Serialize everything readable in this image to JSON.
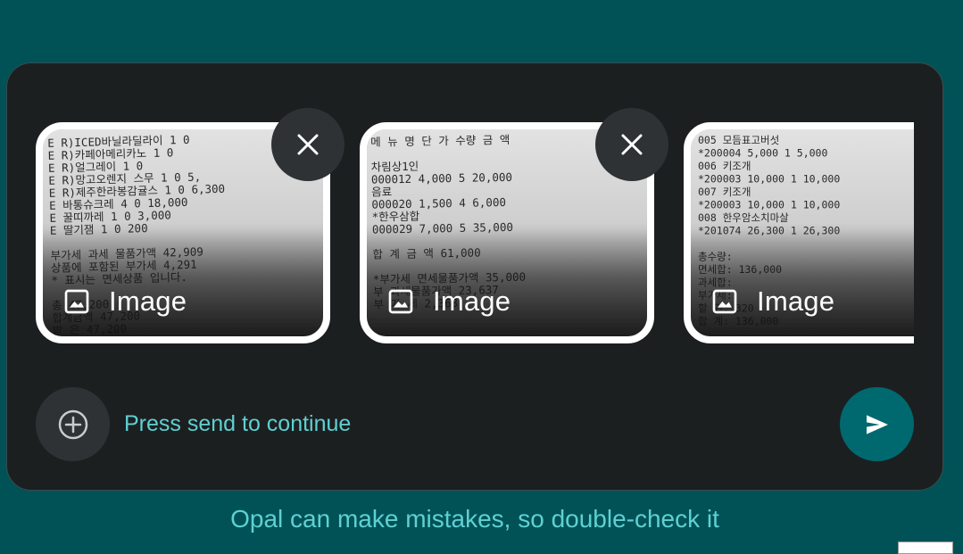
{
  "attachments": [
    {
      "label": "Image",
      "removable": true,
      "receipt_lines": [
        "E R)ICED바닐라딜라이   1    0",
        "E R)카페아메리카노     1    0",
        "E R)얼그레이           1    0",
        "E R)망고오렌지 스무    1    0     5,",
        "E R)제주한라봉감귤스   1    0  6,300",
        "E 바통슈크레           4    0 18,000",
        "E 꿀띠까레             1    0  3,000",
        "E 딸기잼               1    0    200",
        "",
        "부가세 과세 물품가액          42,909",
        "상품에 포함된 부가세           4,291",
        "   * 표시는 면세상품 입니다.",
        "",
        "총                         47,200",
        "합계금액                    47,200",
        "받  은                      47,200"
      ]
    },
    {
      "label": "Image",
      "removable": true,
      "receipt_lines": [
        "  메 뉴 명    단 가  수량   금 액",
        "",
        "차림상1인",
        "000012        4,000   5   20,000",
        "음료",
        "000020        1,500   4    6,000",
        "*한우삼합",
        "000029        7,000   5   35,000",
        "",
        "합 계 금 액               61,000",
        "",
        "*부가세 면세물품가액      35,000",
        " 부  과세물품가액         23,637",
        " 부   가   세              2,363"
      ]
    },
    {
      "label": "Image",
      "removable": false,
      "receipt_lines": [
        "005 모듬표고버섯",
        "*200004      5,000   1    5,000",
        "006 키조개",
        "*200003     10,000   1   10,000",
        "007 키조개",
        "*200003     10,000   1   10,000",
        "008 한우암소치마살",
        "*201074     26,300   1   26,300",
        "",
        "총수량:",
        "면세합:                 136,000",
        "과세합:",
        "부가세:",
        "할  인:                    320",
        "합  계:               136,000"
      ]
    }
  ],
  "composer": {
    "placeholder": "Press send to continue",
    "add_icon": "add-circle-icon",
    "send_icon": "send-icon"
  },
  "footer": {
    "disclaimer": "Opal can make mistakes, so double-check it"
  },
  "colors": {
    "background": "#005257",
    "panel": "#1c1f20",
    "accent_text": "#5fd0d2",
    "send_button": "#00696f",
    "chip_button": "#2e3234"
  }
}
